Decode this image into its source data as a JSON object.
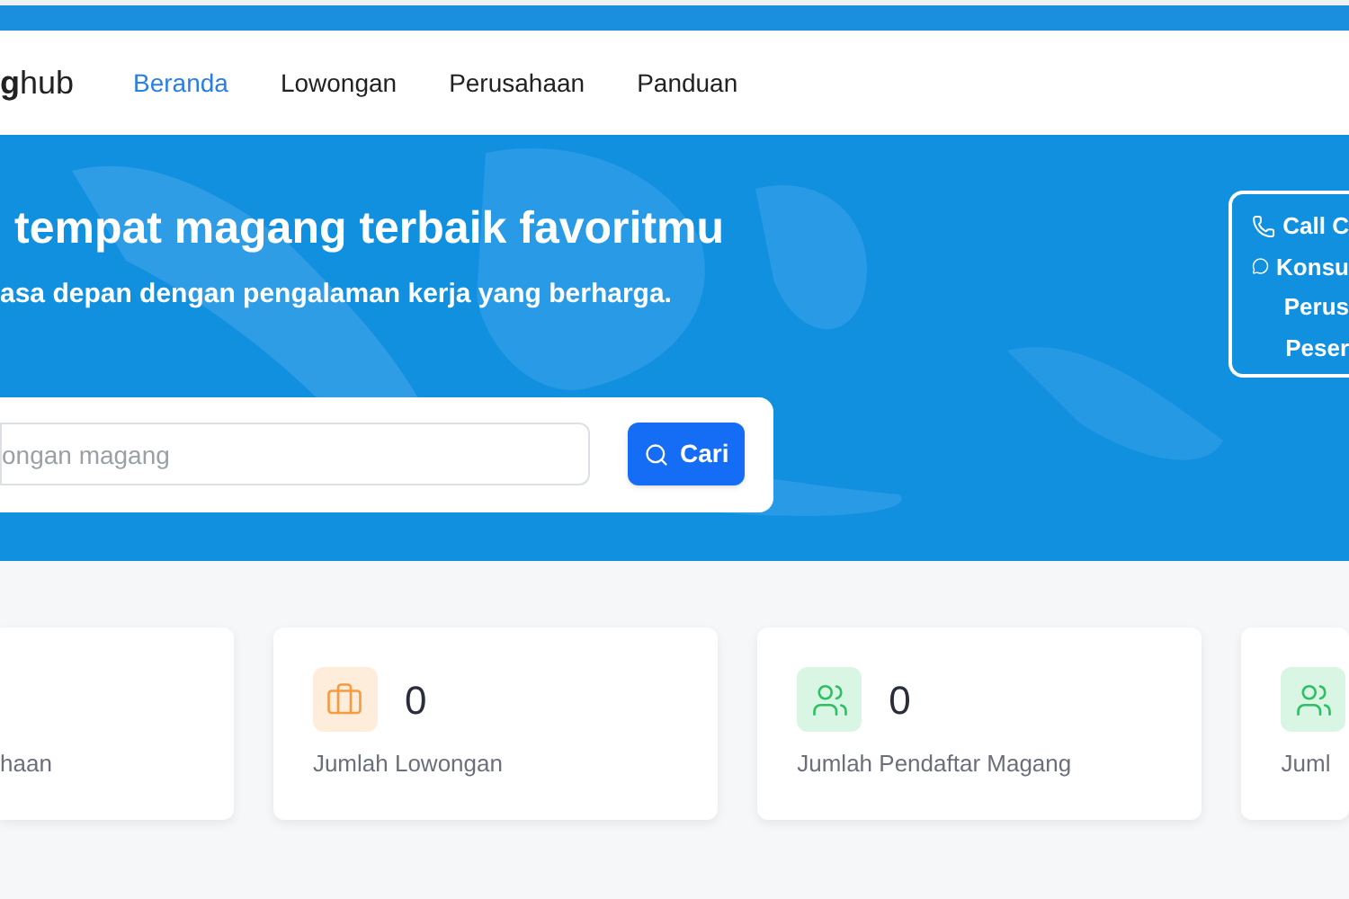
{
  "nav": {
    "logo": {
      "mark": "g",
      "text": "hub"
    },
    "links": [
      {
        "label": "Beranda",
        "selected": true
      },
      {
        "label": "Lowongan",
        "selected": false
      },
      {
        "label": "Perusahaan",
        "selected": false
      },
      {
        "label": "Panduan",
        "selected": false
      }
    ]
  },
  "hero": {
    "title": "tempat magang terbaik favoritmu",
    "subtitle": "asa depan dengan pengalaman kerja yang berharga.",
    "search": {
      "placeholder": "ongan magang"
    },
    "search_button": "Cari"
  },
  "contact_box": [
    {
      "kind": "phone",
      "text": "Call C"
    },
    {
      "kind": "chat",
      "text": "Konsu"
    },
    {
      "kind": "plain",
      "text": "Perus"
    },
    {
      "kind": "plain",
      "text": "Peser"
    }
  ],
  "stats": [
    {
      "kind": "plain",
      "label": "haan"
    },
    {
      "kind": "jobs",
      "value": "0",
      "label": "Jumlah Lowongan"
    },
    {
      "kind": "people",
      "value": "0",
      "label": "Jumlah Pendaftar Magang"
    },
    {
      "kind": "people",
      "label": "Juml"
    }
  ]
}
